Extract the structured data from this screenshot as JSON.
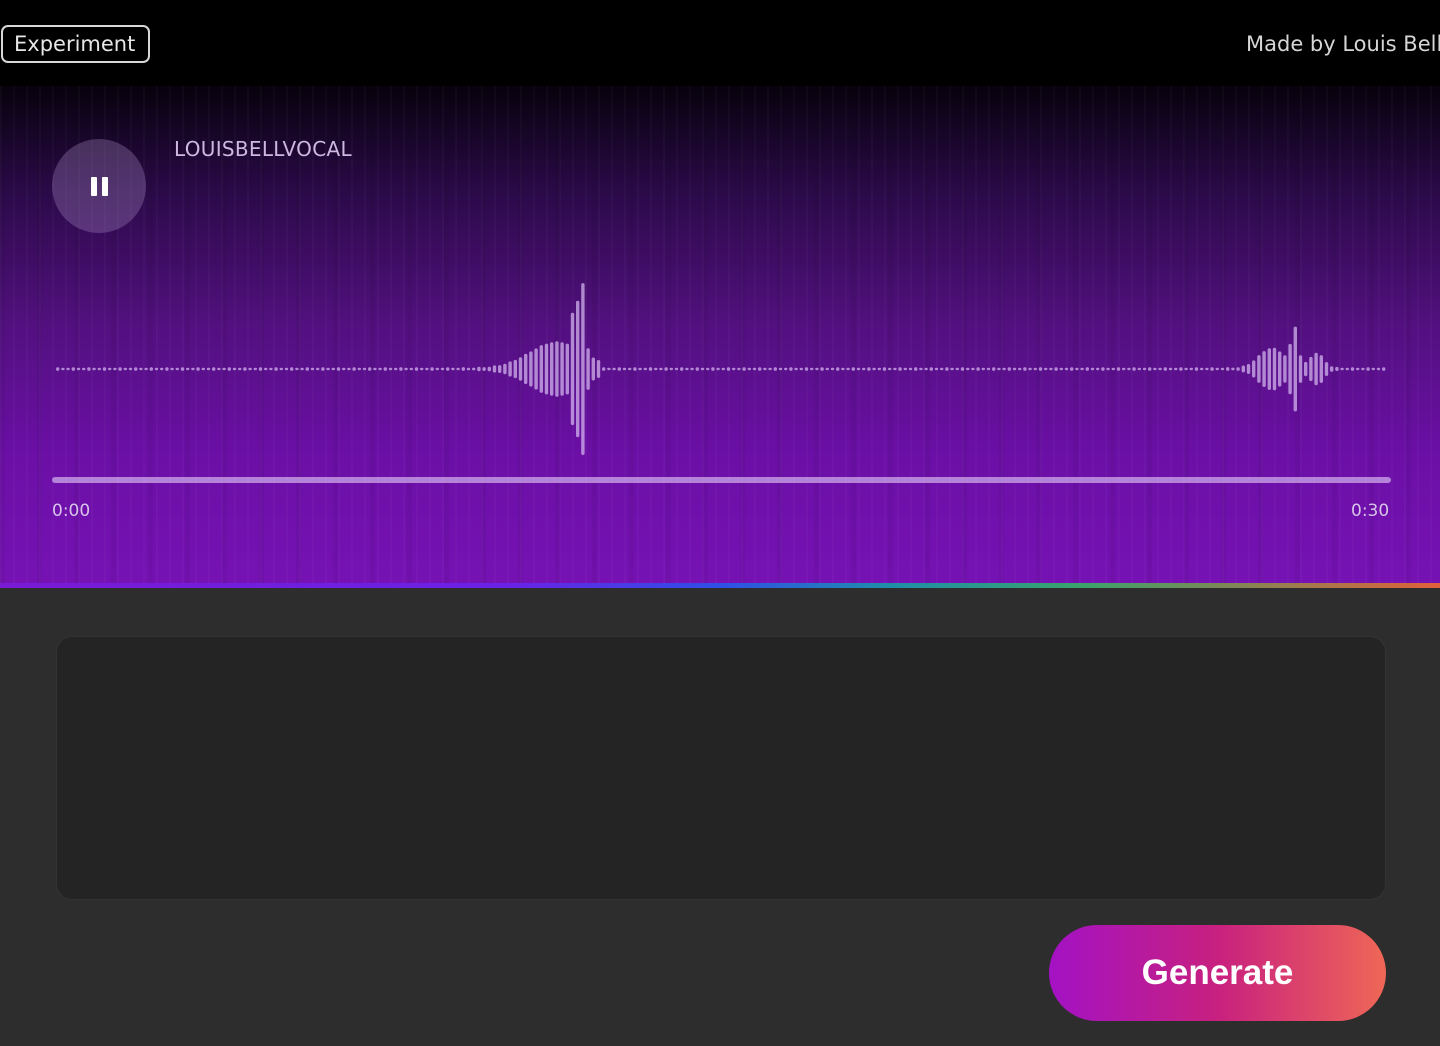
{
  "header": {
    "badge_label": "Experiment",
    "credit_text": "Made by Louis Bell"
  },
  "player": {
    "state": "playing",
    "pause_icon": "pause-icon",
    "track_title": "LOUISBELLVOCAL",
    "time_start": "0:00",
    "time_end": "0:30",
    "progress_fraction": 0.0
  },
  "prompt": {
    "value": "",
    "placeholder": ""
  },
  "actions": {
    "generate_label": "Generate"
  },
  "colors": {
    "accent_start": "#a312c4",
    "accent_end": "#ef6756",
    "player_bg": "#6b0fa6"
  }
}
